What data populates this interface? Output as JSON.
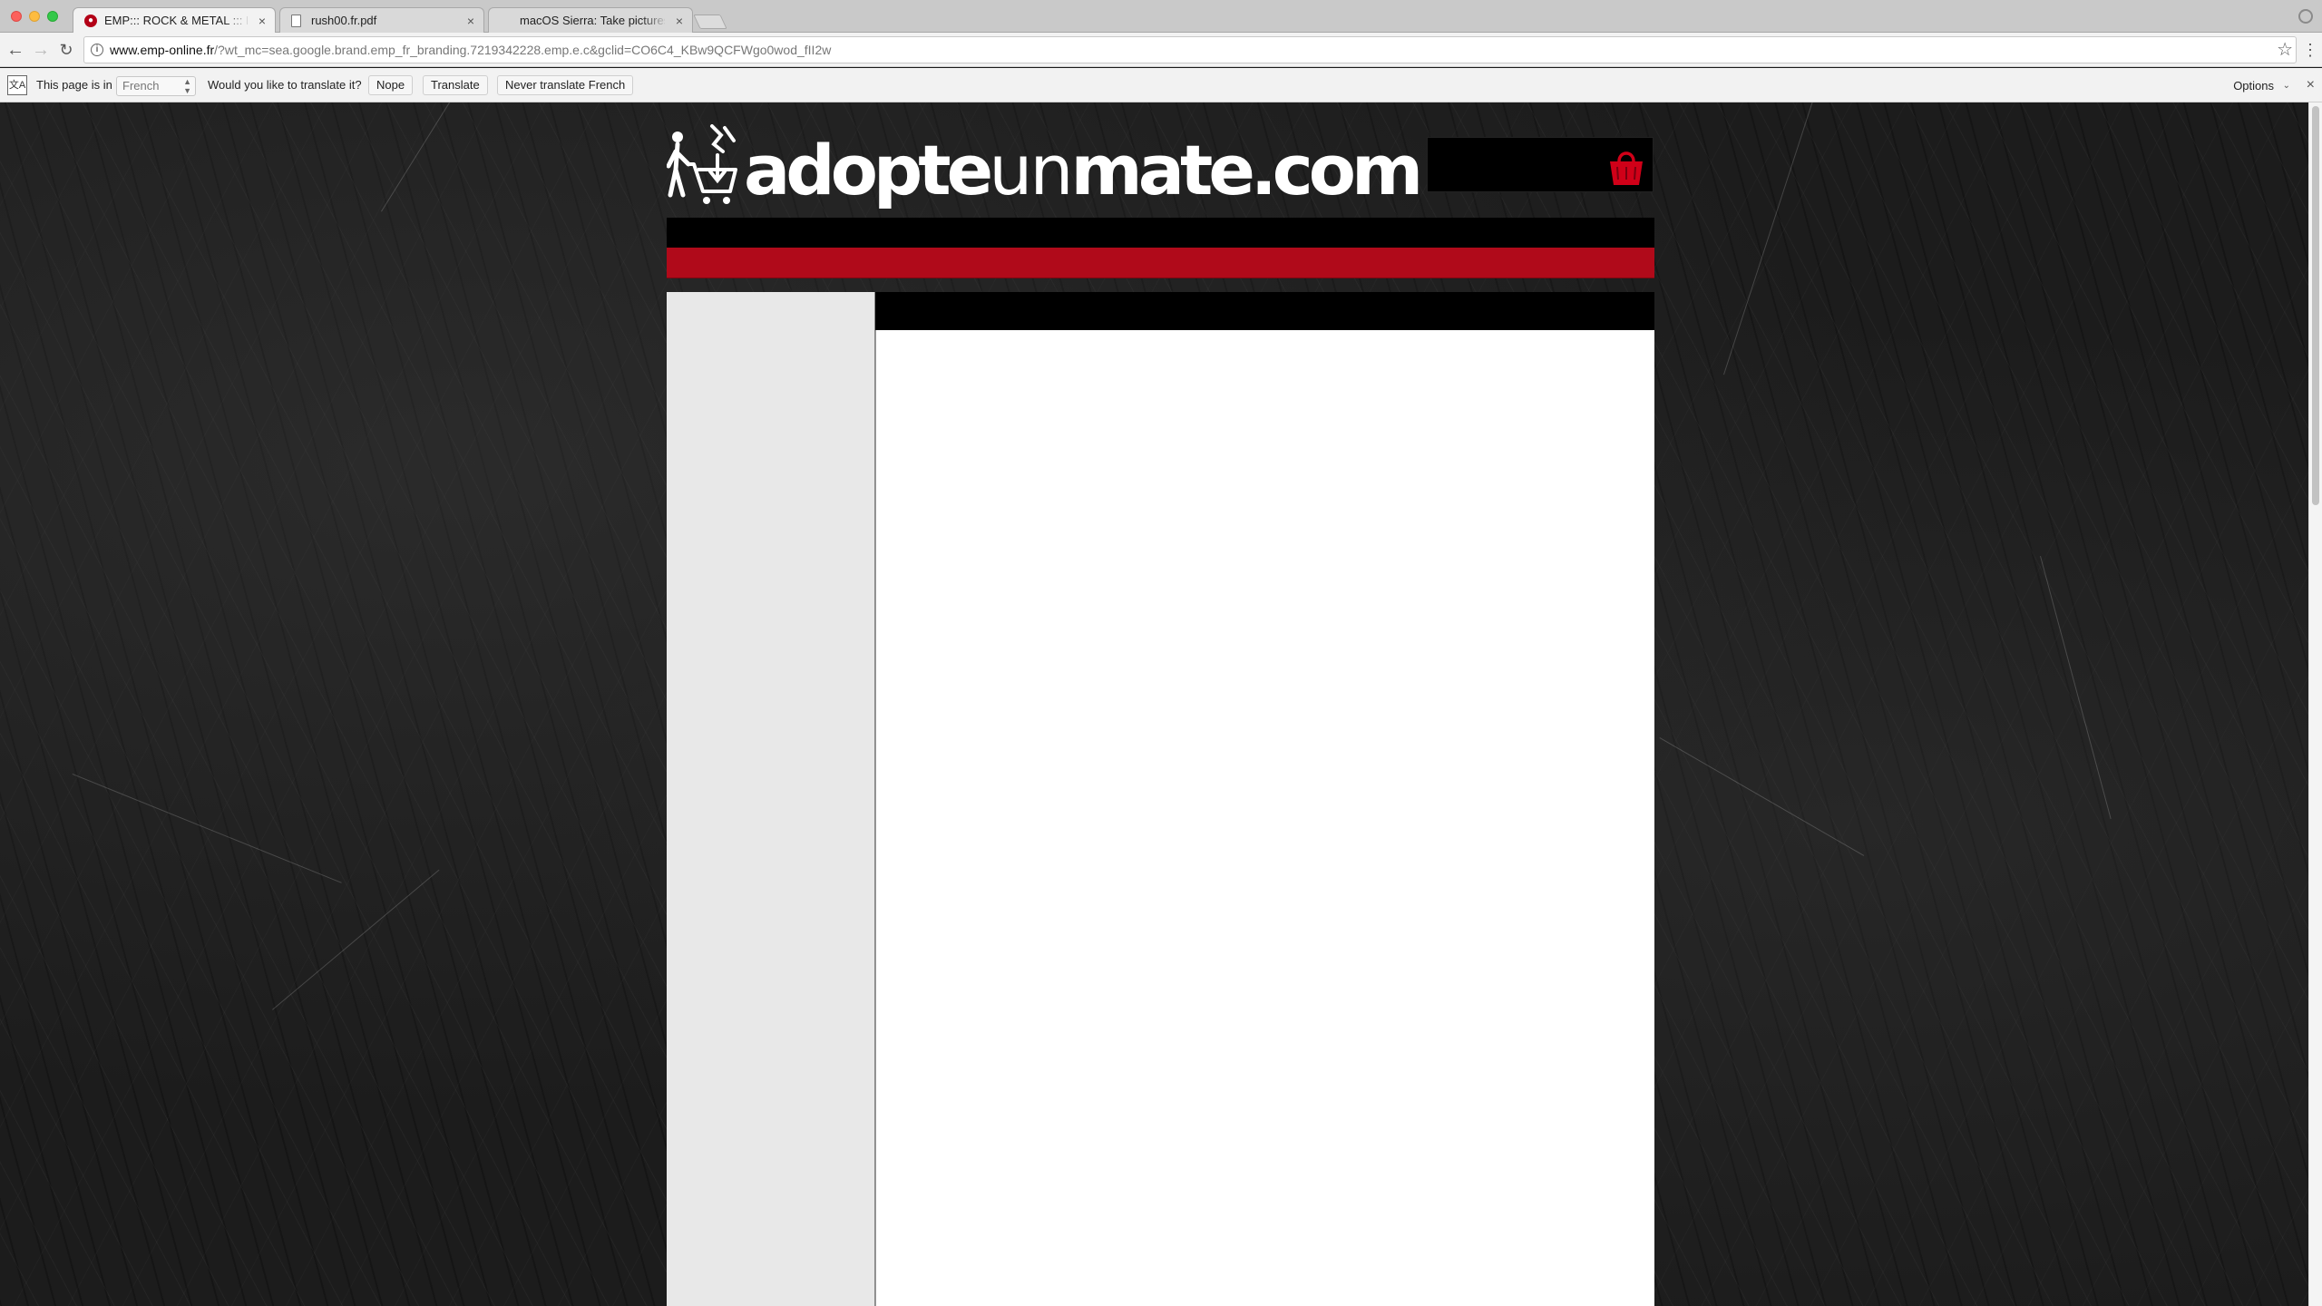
{
  "browser": {
    "tabs": [
      {
        "title": "EMP::: ROCK & METAL ::: Le M",
        "icon": "emp-favicon",
        "active": true
      },
      {
        "title": "rush00.fr.pdf",
        "icon": "document-icon",
        "active": false
      },
      {
        "title": "macOS Sierra: Take pictures o",
        "icon": "apple-icon",
        "active": false
      }
    ],
    "close_glyph": "×",
    "url_host": "www.emp-online.fr",
    "url_rest": "/?wt_mc=sea.google.brand.emp_fr_branding.7219342228.emp.e.c&gclid=CO6C4_KBw9QCFWgo0wod_fII2w"
  },
  "translate_bar": {
    "prefix": "This page is in",
    "language": "French",
    "question": "Would you like to translate it?",
    "nope": "Nope",
    "translate": "Translate",
    "never": "Never translate French",
    "options": "Options"
  },
  "site": {
    "logo_bold_1": "adopte",
    "logo_thin": "un",
    "logo_bold_2": "mate.com",
    "brand_color": "#b00a1a"
  }
}
